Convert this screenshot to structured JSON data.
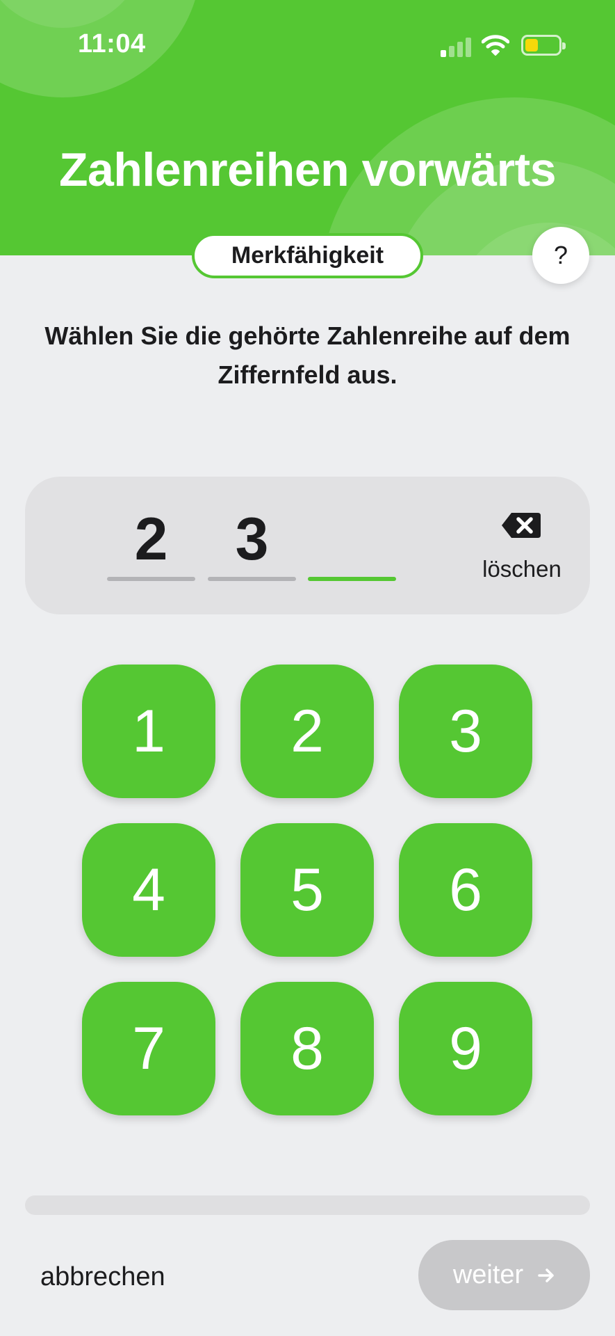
{
  "colors": {
    "accent": "#55c733",
    "background": "#edeef0",
    "battery_fill": "#f5d90a",
    "disabled_button": "#c8c8ca"
  },
  "status_bar": {
    "time": "11:04",
    "icons": [
      "signal-icon",
      "wifi-icon",
      "battery-icon"
    ]
  },
  "header": {
    "title": "Zahlenreihen vorwärts",
    "category": "Merkfähigkeit",
    "help_label": "?"
  },
  "instruction": "Wählen Sie die gehörte Zahlenreihe auf dem Ziffernfeld aus.",
  "entry": {
    "digits": [
      "2",
      "3",
      ""
    ],
    "active_slot": 3,
    "delete_label": "löschen",
    "delete_icon": "backspace-icon"
  },
  "keypad": {
    "keys": [
      "1",
      "2",
      "3",
      "4",
      "5",
      "6",
      "7",
      "8",
      "9"
    ]
  },
  "progress": {
    "value": 0
  },
  "footer": {
    "cancel_label": "abbrechen",
    "next_label": "weiter",
    "next_icon": "arrow-right-icon",
    "next_enabled": false
  }
}
